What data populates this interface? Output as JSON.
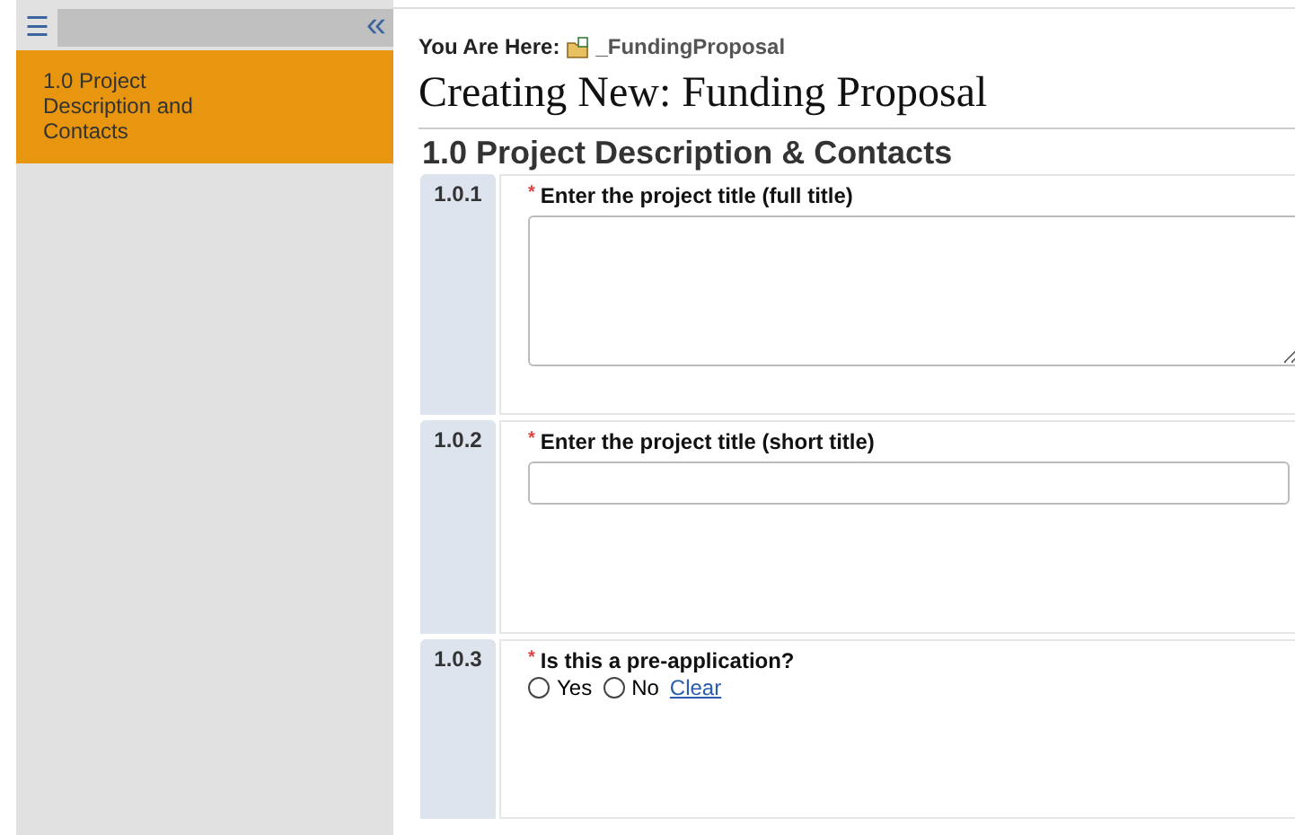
{
  "sidebar": {
    "menu_icon": "☰",
    "collapse_icon": "«",
    "items": [
      {
        "label": "1.0 Project Description and Contacts",
        "selected": true
      }
    ]
  },
  "breadcrumb": {
    "label": "You Are Here:",
    "link": "_FundingProposal"
  },
  "title": "Creating New: Funding Proposal",
  "section": {
    "heading": "1.0 Project Description & Contacts",
    "questions": [
      {
        "number": "1.0.1",
        "required_mark": "*",
        "label": "Enter the project title (full title)",
        "kind": "textarea"
      },
      {
        "number": "1.0.2",
        "required_mark": "*",
        "label": "Enter the project title (short title)",
        "kind": "input"
      },
      {
        "number": "1.0.3",
        "required_mark": "*",
        "label": "Is this a pre-application?",
        "kind": "radio",
        "options": [
          {
            "label": "Yes",
            "selected": false
          },
          {
            "label": "No",
            "selected": false
          }
        ],
        "clear": "Clear"
      }
    ]
  }
}
